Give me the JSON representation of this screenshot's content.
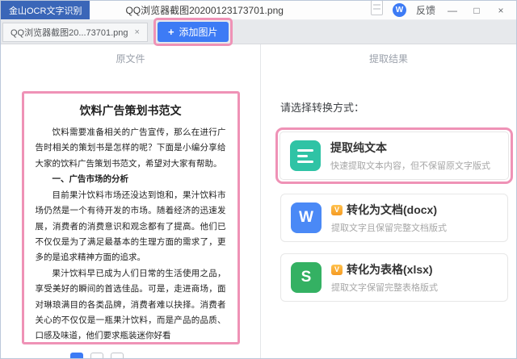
{
  "titlebar": {
    "app_badge": "金山OCR文字识别",
    "filename": "QQ浏览器截图20200123173701.png",
    "wps_logo_letter": "W",
    "feedback": "反馈",
    "controls": {
      "minimize": "—",
      "maximize": "□",
      "close": "×"
    }
  },
  "tabbar": {
    "tab_label": "QQ浏览器截图20...73701.png",
    "tab_close": "×",
    "add_button": {
      "plus": "+",
      "label": "添加图片"
    }
  },
  "panels": {
    "left_header": "原文件",
    "right_header": "提取结果"
  },
  "document": {
    "title": "饮料广告策划书范文",
    "para1": "饮料需要准备相关的广告宣传，那么在进行广告时相关的策划书是怎样的呢？下面是小编分享给大家的饮料广告策划书范文，希望对大家有帮助。",
    "heading1": "一、广告市场的分析",
    "para2": "目前果汁饮料市场还没达到饱和，果汁饮料市场仍然是一个有待开发的市场。随着经济的迅速发展，消费者的消费意识和观念都有了提高。他们已不仅仅是为了满足最基本的生理方面的需求了，更多的是追求精神方面的追求。",
    "para3": "果汁饮料早已成为人们日常的生活使用之品，享受美好的瞬间的首选佳品。可是，走进商场，面对琳琅满目的各类品牌，消费者难以抉择。消费者关心的不仅仅是一瓶果汁饮料，而是产品的品质、口感及味道，他们要求瓶装迷你好看"
  },
  "converter": {
    "prompt": "请选择转换方式：",
    "options": [
      {
        "title": "提取纯文本",
        "subtitle": "快速提取文本内容，但不保留原文字版式",
        "icon": "plain-text-icon",
        "icon_color": "#2fc3a5"
      },
      {
        "title": "转化为文档(docx)",
        "subtitle": "提取文字且保留完整文档版式",
        "icon": "wps-writer-icon",
        "icon_letter": "W",
        "icon_color": "#4a89f6",
        "vip_badge": "V"
      },
      {
        "title": "转化为表格(xlsx)",
        "subtitle": "提取文字保留完整表格版式",
        "icon": "wps-sheet-icon",
        "icon_letter": "S",
        "icon_color": "#34b163",
        "vip_badge": "V"
      }
    ]
  },
  "colors": {
    "accent_blue": "#3d7bf5",
    "annotation_pink": "#ef92b6",
    "badge_blue": "#3a66b8",
    "plain_text_teal": "#2fc3a5",
    "writer_blue": "#4a89f6",
    "sheet_green": "#34b163",
    "vip_gold": "#f59a23"
  }
}
